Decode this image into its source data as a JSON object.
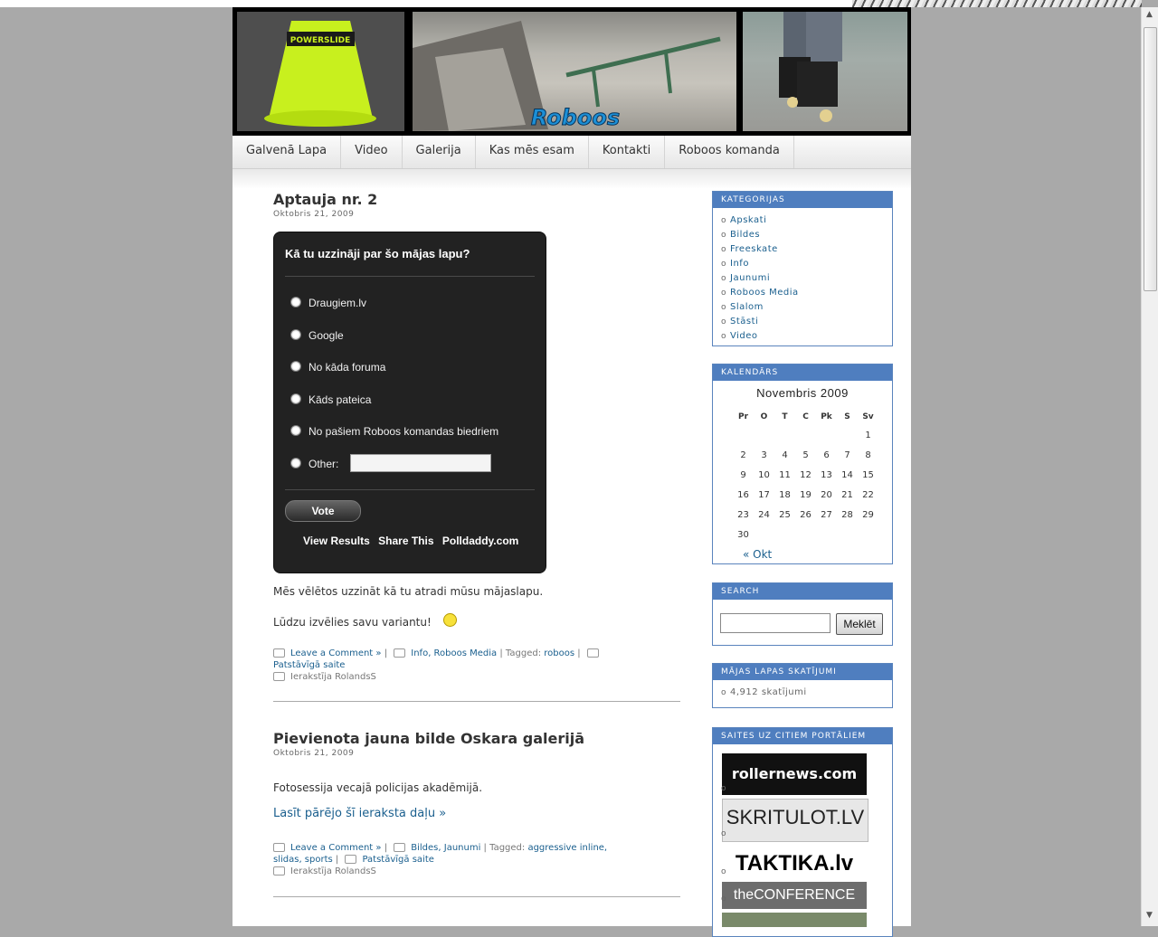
{
  "header": {
    "logo_text": "Roboos",
    "cone_text": "POWERSLIDE"
  },
  "nav": [
    "Galvenā Lapa",
    "Video",
    "Galerija",
    "Kas mēs esam",
    "Kontakti",
    "Roboos komanda"
  ],
  "posts": [
    {
      "title": "Aptauja nr. 2",
      "date": "Oktobris 21, 2009",
      "poll": {
        "question": "Kā tu uzzināji par šo mājas lapu?",
        "options": [
          "Draugiem.lv",
          "Google",
          "No kāda foruma",
          "Kāds pateica",
          "No pašiem Roboos komandas biedriem",
          "Other:"
        ],
        "vote_label": "Vote",
        "links": [
          "View Results",
          "Share This",
          "Polldaddy.com"
        ]
      },
      "paragraphs": [
        "Mēs vēlētos uzzināt kā tu atradi mūsu mājaslapu.",
        "Lūdzu izvēlies savu variantu!"
      ],
      "comment_link": "Leave a Comment »",
      "categories": "Info, Roboos Media",
      "tagged_label": "Tagged:",
      "tags": "roboos",
      "permalink": "Patstāvīgā saite",
      "author": "Ierakstīja RolandsS"
    },
    {
      "title": "Pievienota jauna bilde Oskara galerijā",
      "date": "Oktobris 21, 2009",
      "paragraphs": [
        "Fotosessija vecajā policijas akadēmijā."
      ],
      "more_link": "Lasīt pārējo šī ieraksta daļu »",
      "comment_link": "Leave a Comment »",
      "categories": "Bildes, Jaunumi",
      "tagged_label": "Tagged:",
      "tags_line1": "aggressive inline,",
      "tags_line2": "slidas, sports",
      "permalink": "Patstāvīgā saite",
      "author": "Ierakstīja RolandsS"
    }
  ],
  "sidebar": {
    "categories": {
      "title": "KATEGORIJAS",
      "items": [
        "Apskati",
        "Bildes",
        "Freeskate",
        "Info",
        "Jaunumi",
        "Roboos Media",
        "Slalom",
        "Stāsti",
        "Video"
      ]
    },
    "calendar": {
      "title": "KALENDĀRS",
      "caption": "Novembris 2009",
      "days": [
        "Pr",
        "O",
        "T",
        "C",
        "Pk",
        "S",
        "Sv"
      ],
      "weeks": [
        [
          "",
          "",
          "",
          "",
          "",
          "",
          "1"
        ],
        [
          "2",
          "3",
          "4",
          "5",
          "6",
          "7",
          "8"
        ],
        [
          "9",
          "10",
          "11",
          "12",
          "13",
          "14",
          "15"
        ],
        [
          "16",
          "17",
          "18",
          "19",
          "20",
          "21",
          "22"
        ],
        [
          "23",
          "24",
          "25",
          "26",
          "27",
          "28",
          "29"
        ],
        [
          "30",
          "",
          "",
          "",
          "",
          "",
          ""
        ]
      ],
      "prev": "« Okt"
    },
    "search": {
      "title": "SEARCH",
      "button": "Meklēt"
    },
    "views": {
      "title": "MĀJAS LAPAS SKATĪJUMI",
      "value": "4,912 skatījumi"
    },
    "links": {
      "title": "SAITES UZ CITIEM PORTĀLIEM",
      "banners": [
        "rollernews.com",
        "SKRITULOT.LV",
        "TAKTIKA.lv",
        "theCONFERENCE"
      ]
    }
  }
}
